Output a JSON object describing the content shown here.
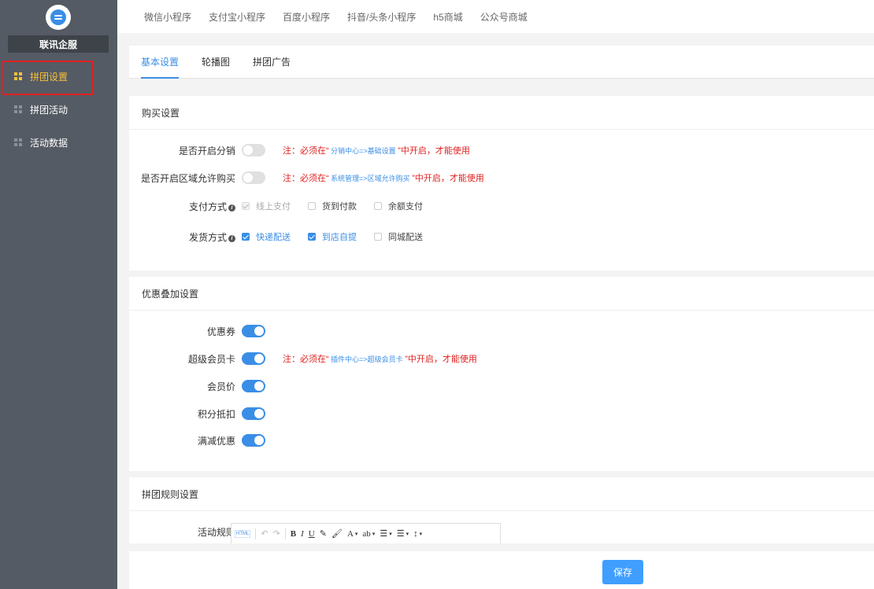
{
  "sidebar": {
    "brand": "联讯企服",
    "items": [
      {
        "label": "拼团设置",
        "active": true
      },
      {
        "label": "拼团活动",
        "active": false
      },
      {
        "label": "活动数据",
        "active": false
      }
    ]
  },
  "topnav": [
    "微信小程序",
    "支付宝小程序",
    "百度小程序",
    "抖音/头条小程序",
    "h5商城",
    "公众号商城"
  ],
  "tabs": [
    "基本设置",
    "轮播图",
    "拼团广告"
  ],
  "purchase": {
    "title": "购买设置",
    "distribution_label": "是否开启分销",
    "distribution_note_pre": "注：必须在“",
    "distribution_note_link": " 分销中心=>基础设置 ",
    "distribution_note_post": "”中开启，才能使用",
    "region_label": "是否开启区域允许购买",
    "region_note_pre": "注：必须在“",
    "region_note_link": " 系统管理=>区域允许购买 ",
    "region_note_post": "”中开启，才能使用",
    "pay_label": "支付方式",
    "pay_options": [
      "线上支付",
      "货到付款",
      "余额支付"
    ],
    "ship_label": "发货方式",
    "ship_options": [
      "快递配送",
      "到店自提",
      "同城配送"
    ]
  },
  "discount": {
    "title": "优惠叠加设置",
    "coupon_label": "优惠券",
    "vip_label": "超级会员卡",
    "vip_note_pre": "注：必须在“",
    "vip_note_link": " 插件中心=>超级会员卡 ",
    "vip_note_post": "”中开启，才能使用",
    "member_price_label": "会员价",
    "points_label": "积分抵扣",
    "full_reduce_label": "满减优惠"
  },
  "rules": {
    "title": "拼团规则设置",
    "activity_rule_label": "活动规则",
    "editor_html": "HTML"
  },
  "footer": {
    "save_label": "保存"
  },
  "colors": {
    "accent": "#3a8ee6",
    "warning": "#e02020",
    "active_nav": "#f7c13a",
    "sidebar_bg": "#555b64"
  }
}
